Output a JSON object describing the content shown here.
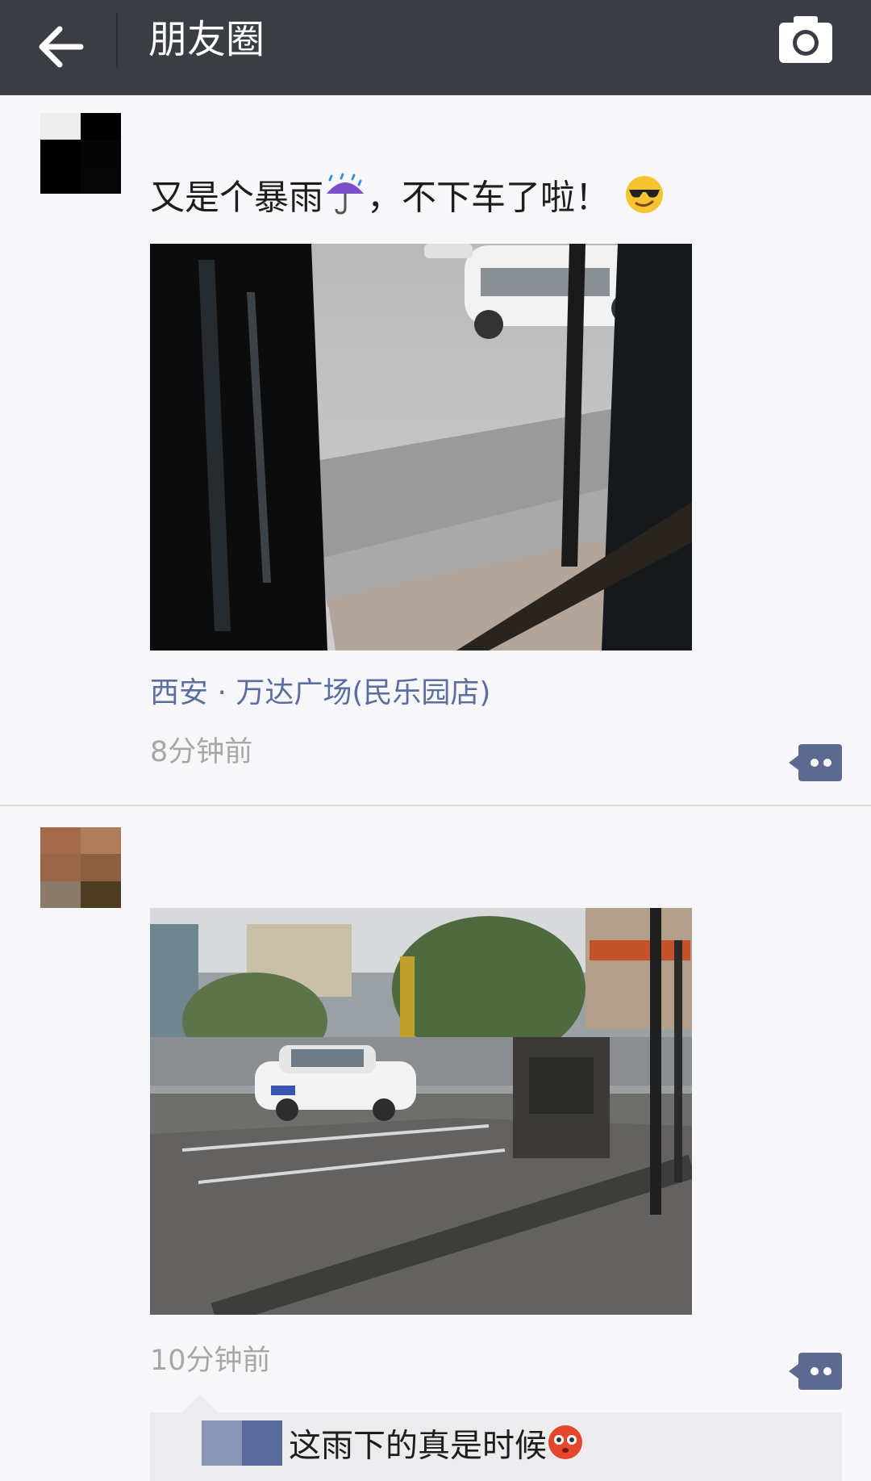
{
  "header": {
    "title": "朋友圈",
    "back_icon": "arrow-left-icon",
    "camera_icon": "camera-icon"
  },
  "posts": [
    {
      "text_before": "又是个暴雨",
      "emoji_1": "umbrella-rain-emoji",
      "text_after": "，不下车了啦！",
      "emoji_2": "cool-sunglasses-emoji",
      "location": "西安 · 万达广场(民乐园店)",
      "time": "8分钟前",
      "photo": "rain-window-photo"
    },
    {
      "time": "10分钟前",
      "photo": "rainy-parking-lot-photo",
      "comment": {
        "text": "这雨下的真是时候",
        "emoji": "flushed-face-emoji"
      }
    }
  ],
  "colors": {
    "topbar": "#3a3d43",
    "link": "#5a6ea0",
    "time": "#a7a7a7",
    "comment_icon": "#5d6a8f"
  }
}
